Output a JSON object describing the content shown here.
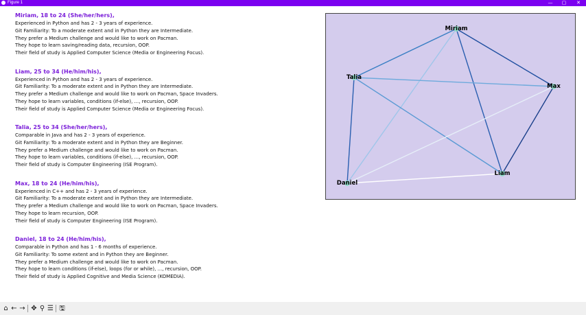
{
  "window": {
    "title": "Figure 1",
    "minimize_glyph": "—",
    "maximize_glyph": "▢",
    "close_glyph": "✕"
  },
  "profiles": [
    {
      "header": "Miriam, 18 to 24 (She/her/hers),",
      "lines": [
        "Experienced in Python and has 2 - 3 years of experience.",
        "Git Familiarity: To a moderate extent and in Python they are Intermediate.",
        "They prefer a Medium challenge and would like to work on Pacman.",
        "They hope to learn saving/reading data, recursion, OOP.",
        "Their field of study is Applied Computer Science (Media or Engineering Focus)."
      ]
    },
    {
      "header": "Liam, 25 to 34 (He/him/his),",
      "lines": [
        "Experienced in Python and has 2 - 3 years of experience.",
        "Git Familiarity: To a moderate extent and in Python they are Intermediate.",
        "They prefer a Medium challenge and would like to work on Pacman, Space Invaders.",
        "They hope to learn variables, conditions (if-else), ..., recursion, OOP.",
        "Their field of study is Applied Computer Science (Media or Engineering Focus)."
      ]
    },
    {
      "header": "Talia, 25 to 34 (She/her/hers),",
      "lines": [
        "Comparable in Java and has 2 - 3 years of experience.",
        "Git Familiarity: To a moderate extent and in Python they are Beginner.",
        "They prefer a Medium challenge and would like to work on Pacman.",
        "They hope to learn variables, conditions (if-else), ..., recursion, OOP.",
        "Their field of study is Computer Engineering (ISE Program)."
      ]
    },
    {
      "header": "Max, 18 to 24 (He/him/his),",
      "lines": [
        "Experienced in C++ and has 2 - 3 years of experience.",
        "Git Familiarity: To a moderate extent and in Python they are Intermediate.",
        "They prefer a Medium challenge and would like to work on Pacman, Space Invaders.",
        "They hope to learn recursion, OOP.",
        "Their field of study is Computer Engineering (ISE Program)."
      ]
    },
    {
      "header": "Daniel, 18 to 24 (He/him/his),",
      "lines": [
        "Comparable in Python and has 1 - 6 months of experience.",
        "Git Familiarity: To some extent and in Python they are Beginner.",
        "They prefer a Medium challenge and would like to work on Pacman.",
        "They hope to learn conditions (if-else), loops (for or while), ..., recursion, OOP.",
        "Their field of study is Applied Cognitive and Media Science (KOMEDIA)."
      ]
    }
  ],
  "graph": {
    "background": "#d4cced",
    "node_color": "#8fdcc8",
    "nodes": [
      {
        "id": "Miriam",
        "label": "Miriam"
      },
      {
        "id": "Talia",
        "label": "Talia"
      },
      {
        "id": "Max",
        "label": "Max"
      },
      {
        "id": "Liam",
        "label": "Liam"
      },
      {
        "id": "Daniel",
        "label": "Daniel"
      }
    ],
    "edges": [
      {
        "from": "Miriam",
        "to": "Talia",
        "color": "#3a7fc4"
      },
      {
        "from": "Miriam",
        "to": "Max",
        "color": "#1f4fa0"
      },
      {
        "from": "Miriam",
        "to": "Liam",
        "color": "#2a5fb0"
      },
      {
        "from": "Miriam",
        "to": "Daniel",
        "color": "#9fc6ea"
      },
      {
        "from": "Talia",
        "to": "Max",
        "color": "#6eaadc"
      },
      {
        "from": "Talia",
        "to": "Liam",
        "color": "#5a9ad4"
      },
      {
        "from": "Talia",
        "to": "Daniel",
        "color": "#2a5fb0"
      },
      {
        "from": "Max",
        "to": "Liam",
        "color": "#1a3f8a"
      },
      {
        "from": "Max",
        "to": "Daniel",
        "color": "#e6eef8"
      },
      {
        "from": "Liam",
        "to": "Daniel",
        "color": "#ffffff"
      }
    ]
  },
  "toolbar": {
    "home_icon": "home-icon",
    "back_icon": "back-arrow-icon",
    "forward_icon": "forward-arrow-icon",
    "pan_icon": "pan-icon",
    "zoom_icon": "zoom-icon",
    "configure_icon": "configure-subplots-icon",
    "save_icon": "save-icon"
  }
}
